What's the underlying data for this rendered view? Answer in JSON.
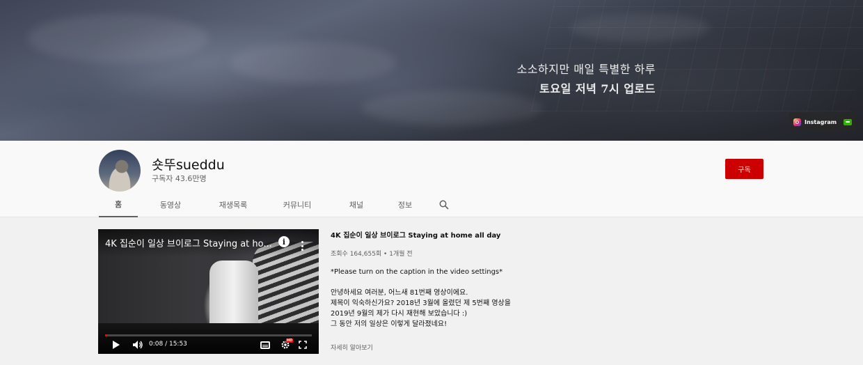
{
  "banner": {
    "line1": "소소하지만 매일 특별한 하루",
    "line2": "토요일 저녁 7시 업로드",
    "links": {
      "instagram_label": "Instagram"
    }
  },
  "channel": {
    "name": "숏뚜sueddu",
    "subscribers": "구독자 43.6만명",
    "subscribe_label": "구독"
  },
  "tabs": [
    {
      "label": "홈",
      "active": true
    },
    {
      "label": "동영상"
    },
    {
      "label": "재생목록"
    },
    {
      "label": "커뮤니티"
    },
    {
      "label": "채널"
    },
    {
      "label": "정보"
    }
  ],
  "featured": {
    "player_title": "4K 집순이 일상 브이로그 Staying at ho...",
    "time": "0:08 / 15:53",
    "progress": 0.0084,
    "title": "4K 집순이 일상 브이로그 Staying at home all day",
    "meta": "조회수 164,655회 • 1개월 전",
    "description": [
      "*Please turn on the caption in the video settings*",
      "",
      "안녕하세요 여러분, 어느새 81번째 영상이에요.",
      "제목이 익숙하신가요? 2018년 3월에 올렸던 제 5번째 영상을",
      "2019년 9월의 제가 다시 재현해 보았습니다 :)",
      "그 동안 저의 일상은 이렇게 달라졌네요!"
    ],
    "read_more": "자세히 알아보기"
  },
  "icons": {
    "search": "search-icon",
    "info": "info-icon",
    "more": "kebab-icon",
    "play": "play-icon",
    "volume": "volume-icon",
    "captions": "cc-icon",
    "settings": "gear-icon",
    "fullscreen": "fullscreen-icon"
  },
  "colors": {
    "subscribe": "#cc0000",
    "progress": "#ff0000"
  }
}
